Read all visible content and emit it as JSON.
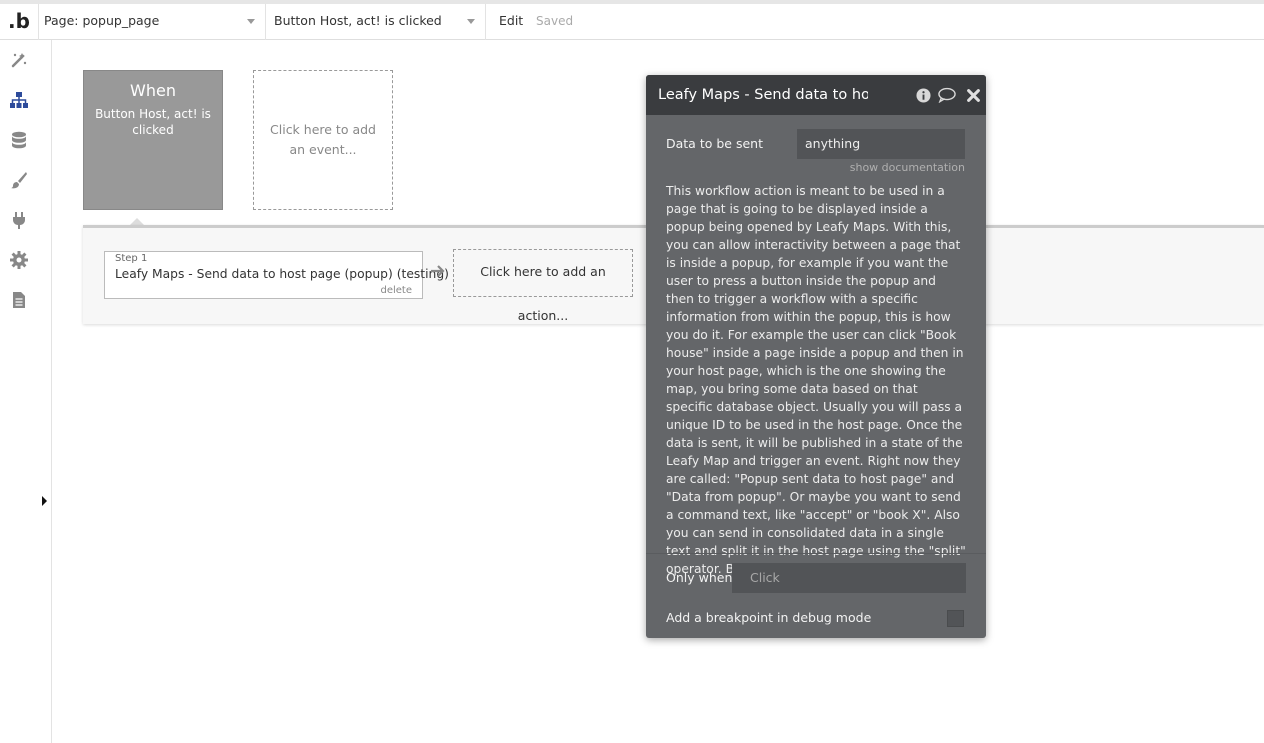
{
  "topbar": {
    "logo": ".b",
    "page_select": "Page: popup_page",
    "workflow_select": "Button Host, act! is clicked",
    "edit_label": "Edit",
    "saved_label": "Saved"
  },
  "sidebar": {
    "icons": [
      "design-icon",
      "workflow-icon",
      "data-icon",
      "styles-icon",
      "plugins-icon",
      "settings-icon",
      "logs-icon"
    ]
  },
  "event": {
    "title": "When",
    "subtitle": "Button Host, act! is clicked",
    "add_event": "Click here to add an event..."
  },
  "steps": [
    {
      "number": "Step 1",
      "name": "Leafy Maps - Send data to host page (popup) (testing)",
      "delete": "delete"
    }
  ],
  "add_action": "Click here to add an action...",
  "popup": {
    "title": "Leafy Maps - Send data to host p",
    "data_label": "Data to be sent",
    "data_value": "anything",
    "show_documentation": "show documentation",
    "description": "This workflow action is meant to be used in a page that is going to be displayed inside a popup being opened by Leafy Maps. With this, you can allow interactivity between a page that is inside a popup, for example if you want the user to press a button inside the popup and then to trigger a workflow with a specific information from within the popup, this is how you do it. For example the user can click \"Book house\" inside a page inside a popup and then in your host page, which is the one showing the map, you bring some data based on that specific database object. Usually you will pass a unique ID to be used in the host page. Once the data is sent, it will be published in a state of the Leafy Map and trigger an event. Right now they are called: \"Popup sent data to host page\" and \"Data from popup\". Or maybe you want to send a command text, like \"accept\" or \"book X\". Also you can send in consolidated data in a single text and split it in the host page using the \"split\" operator. Be creative, you are a developer! (:",
    "only_when_label": "Only when",
    "only_when_placeholder": "Click",
    "breakpoint_label": "Add a breakpoint in debug mode"
  },
  "colors": {
    "popup_bg": "#646669",
    "popup_header": "#3a3c3f",
    "when_box": "#999999",
    "accent_blue": "#2d4b9b"
  }
}
